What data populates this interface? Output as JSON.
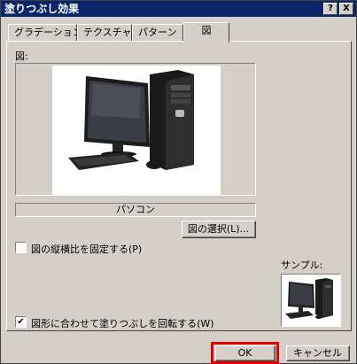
{
  "window": {
    "title": "塗りつぶし効果",
    "help_button": "?",
    "close_button": "X"
  },
  "tabs": [
    {
      "label": "グラデーション"
    },
    {
      "label": "テクスチャ"
    },
    {
      "label": "パターン"
    },
    {
      "label": "図"
    }
  ],
  "picture": {
    "section_label": "図:",
    "image_name": "パソコン",
    "select_button": "図の選択(L)..."
  },
  "lock_ratio": {
    "label": "図の縦横比を固定する(P)",
    "checked": false
  },
  "rotate_with_shape": {
    "label": "図形に合わせて塗りつぶしを回転する(W)",
    "checked": true,
    "check_mark": "✔"
  },
  "sample": {
    "label": "サンプル:"
  },
  "footer": {
    "ok": "OK",
    "cancel": "キャンセル"
  }
}
